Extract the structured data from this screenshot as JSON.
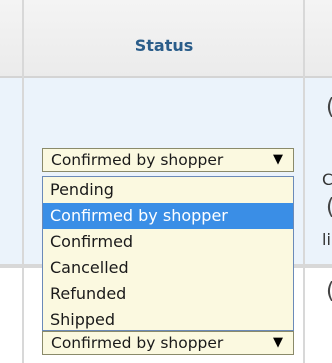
{
  "table": {
    "header": {
      "status_label": "Status"
    },
    "rows": [
      {
        "status_select": {
          "value": "Confirmed by shopper",
          "arrow": "▼"
        },
        "side_fragments": [
          "C",
          "li"
        ]
      },
      {
        "status_select": {
          "value": "Confirmed by shopper",
          "arrow": "▼"
        }
      }
    ],
    "dropdown": {
      "options": [
        "Pending",
        "Confirmed by shopper",
        "Confirmed",
        "Cancelled",
        "Refunded",
        "Shipped"
      ],
      "highlighted": "Confirmed by shopper"
    }
  },
  "colors": {
    "header_text": "#2a5d8a",
    "row_highlight": "#ebf3fb",
    "select_bg": "#fbf9e0",
    "option_selected_bg": "#3a8ee6"
  }
}
